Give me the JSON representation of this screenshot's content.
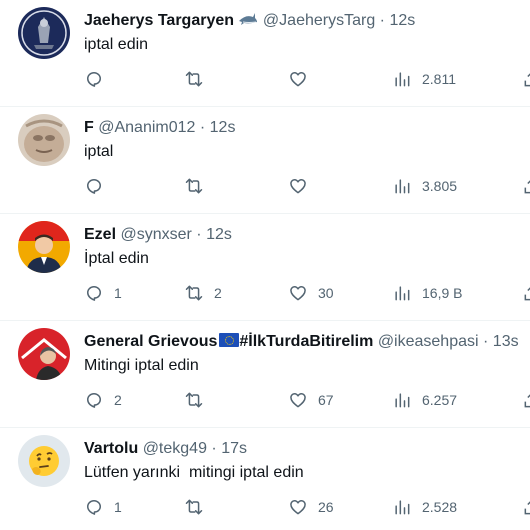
{
  "tweets": [
    {
      "name": "Jaeherys Targaryen",
      "name_emoji": "shark",
      "handle": "@JaeherysTarg",
      "dot": "·",
      "time": "12s",
      "text": "iptal edin",
      "reply_count": "",
      "retweet_count": "",
      "like_count": "",
      "views": "2.811",
      "avatar_color": "#1c2a5a"
    },
    {
      "name": "F",
      "handle": "@Ananim012",
      "dot": "·",
      "time": "12s",
      "text": "iptal",
      "reply_count": "",
      "retweet_count": "",
      "like_count": "",
      "views": "3.805",
      "avatar_color": "#c9b8a8"
    },
    {
      "name": "Ezel",
      "handle": "@synxser",
      "dot": "·",
      "time": "12s",
      "text": "İptal edin",
      "reply_count": "1",
      "retweet_count": "2",
      "like_count": "30",
      "views": "16,9 B",
      "avatar_color": "#f2a900"
    },
    {
      "name": "General Grievous",
      "name_suffix": "#İlkTurdaBitirelim",
      "name_emoji": "eu-flag",
      "handle": "@ikeasehpasi",
      "dot": "·",
      "time": "13s",
      "text": "Mitingi iptal edin",
      "reply_count": "2",
      "retweet_count": "",
      "like_count": "67",
      "views": "6.257",
      "avatar_color": "#d8232a"
    },
    {
      "name": "Vartolu",
      "handle": "@tekg49",
      "dot": "·",
      "time": "17s",
      "text": "Lütfen yarınki  mitingi iptal edin",
      "reply_count": "1",
      "retweet_count": "",
      "like_count": "26",
      "views": "2.528",
      "avatar_color": "#e1e8ed"
    }
  ],
  "colors": {
    "text": "#0f1419",
    "secondary": "#536471",
    "divider": "#eff3f4"
  }
}
